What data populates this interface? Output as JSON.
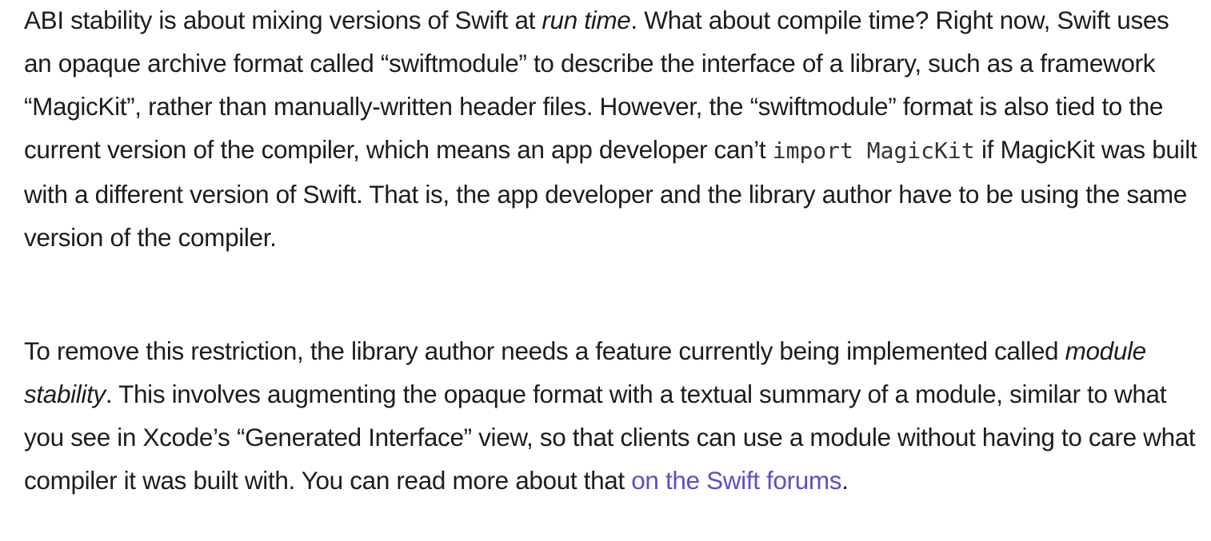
{
  "article": {
    "paragraphs": [
      {
        "segments": [
          "ABI stability is about mixing versions of Swift at ",
          "run time",
          ". What about compile time? Right now, Swift uses an opaque archive format called “swiftmodule” to describe the interface of a library, such as a framework “MagicKit”, rather than manually-written header files. However, the “swiftmodule” format is also tied to the current version of the compiler, which means an app developer can’t ",
          "import MagicKit",
          " if MagicKit was built with a different version of Swift. That is, the app developer and the library author have to be using the same version of the compiler."
        ]
      },
      {
        "segments": [
          "To remove this restriction, the library author needs a feature currently being implemented called ",
          "module stability",
          ". This involves augmenting the opaque format with a textual summary of a module, similar to what you see in Xcode’s “Generated Interface” view, so that clients can use a module without having to care what compiler it was built with. You can read more about that ",
          "on the Swift forums",
          "."
        ]
      }
    ]
  },
  "colors": {
    "text": "#1d1d1f",
    "link": "#5b4fc9",
    "code": "#333333",
    "background": "#ffffff"
  }
}
